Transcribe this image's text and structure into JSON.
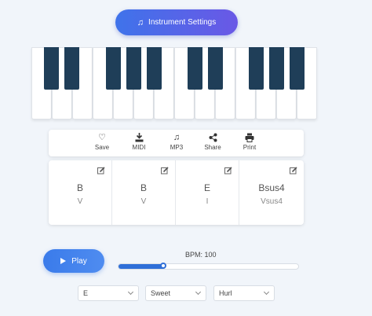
{
  "instrument_button": {
    "label": "Instrument Settings",
    "icon": "music-note-icon"
  },
  "toolbar": {
    "items": [
      {
        "label": "Save",
        "icon": "heart-icon"
      },
      {
        "label": "MIDI",
        "icon": "download-icon"
      },
      {
        "label": "MP3",
        "icon": "music-note-icon"
      },
      {
        "label": "Share",
        "icon": "share-icon"
      },
      {
        "label": "Print",
        "icon": "printer-icon"
      }
    ]
  },
  "chords": [
    {
      "name": "B",
      "roman": "V"
    },
    {
      "name": "B",
      "roman": "V"
    },
    {
      "name": "E",
      "roman": "I"
    },
    {
      "name": "Bsus4",
      "roman": "Vsus4"
    }
  ],
  "player": {
    "play_label": "Play",
    "bpm_label": "BPM: 100",
    "bpm_slider_fraction": 0.25
  },
  "selects": {
    "key": "E",
    "mood": "Sweet",
    "style": "Hurl"
  },
  "colors": {
    "accent": "#3f73ea",
    "black_key": "#1f3e58",
    "slider": "#2f6fd8"
  }
}
